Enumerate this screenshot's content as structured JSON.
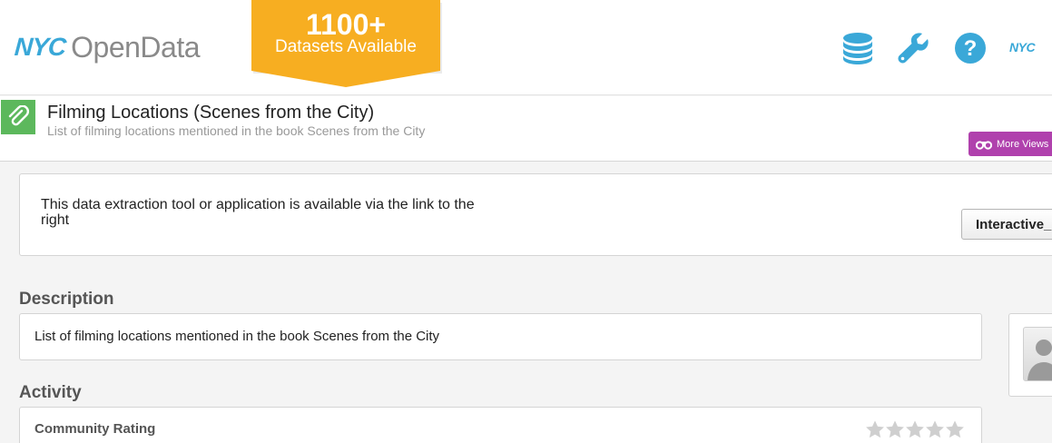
{
  "header": {
    "logo_nyc": "NYC",
    "logo_opendata": "OpenData",
    "banner_count": "1100+",
    "banner_text": "Datasets Available",
    "icons": [
      "database-icon",
      "wrench-icon",
      "help-icon"
    ],
    "nyc_mini": "NYC",
    "brand_color": "#3aa8d8",
    "banner_color": "#f7ae21"
  },
  "dataset": {
    "title": "Filming Locations (Scenes from the City)",
    "subtitle": "List of filming locations mentioned in the book Scenes from the City",
    "more_views_label": "More Views"
  },
  "notice": {
    "text": "This data extraction tool or application is available via the link to the right",
    "button_label": "Interactive_Map"
  },
  "description": {
    "heading": "Description",
    "text": "List of filming locations mentioned in the book Scenes from the City"
  },
  "activity": {
    "heading": "Activity",
    "rating_label": "Community Rating",
    "rating_value": 0,
    "rating_max": 5
  }
}
